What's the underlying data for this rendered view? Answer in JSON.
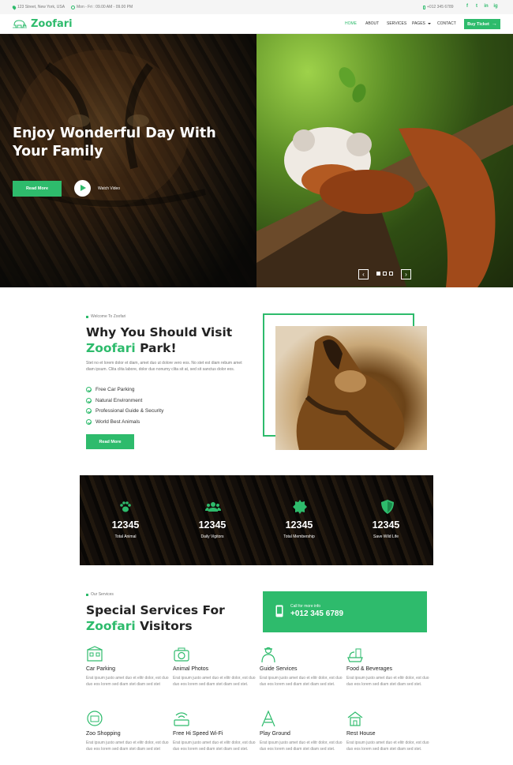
{
  "topbar": {
    "address": "123 Street, New York, USA",
    "hours": "Mon - Fri : 09.00 AM - 09.00 PM",
    "phone": "+012 345 6789",
    "social": [
      "f",
      "t",
      "in",
      "ig"
    ]
  },
  "brand": {
    "name": "Zoofari",
    "color": "#2ebb6c"
  },
  "nav": {
    "items": [
      "HOME",
      "ABOUT",
      "SERVICES",
      "PAGES",
      "CONTACT"
    ],
    "buy_ticket": "Buy Ticket"
  },
  "hero": {
    "title": "Enjoy Wonderful Day With Your Family",
    "read_more": "Read More",
    "watch_video": "Watch Video",
    "prev": "‹",
    "next": "›"
  },
  "about": {
    "tag": "Welcome To Zoofari",
    "heading_line1": "Why You Should Visit",
    "heading_green": "Zoofari",
    "heading_rest": " Park!",
    "paragraph": "Stet no et lorem dolor et diam, amet duo ut dolore vero eos. No stet est diam rebum amet diam ipsum. Clita clita labore, dolor duo nonumy clita sit at, sed sit sanctus dolor eos.",
    "features": [
      "Free Car Parking",
      "Natural Environment",
      "Professional Guide & Security",
      "World Best Animals"
    ],
    "read_more": "Read More"
  },
  "stats": [
    {
      "icon": "paw-icon",
      "value": "12345",
      "label": "Total Animal"
    },
    {
      "icon": "users-icon",
      "value": "12345",
      "label": "Daily Vigitors"
    },
    {
      "icon": "certificate-icon",
      "value": "12345",
      "label": "Total Membership"
    },
    {
      "icon": "shield-icon",
      "value": "12345",
      "label": "Save Wild Life"
    }
  ],
  "services": {
    "tag": "Our Services",
    "heading_line1": "Special Services For",
    "heading_green": "Zoofari",
    "heading_rest": " Visitors",
    "call_label": "Call for more info",
    "call_number": "+012 345 6789",
    "items": [
      {
        "icon": "car-parking-icon",
        "title": "Car Parking",
        "desc": "Erat ipsum justo amet duo et elitr dolor, est duo duo eos lorem sed diam stet diam sed stet"
      },
      {
        "icon": "camera-icon",
        "title": "Animal Photos",
        "desc": "Erat ipsum justo amet duo et elitr dolor, est duo duo eos lorem sed diam stet diam sed stet."
      },
      {
        "icon": "guide-icon",
        "title": "Guide Services",
        "desc": "Erat ipsum justo amet duo et elitr dolor, est duo duo eos lorem sed diam stet diam sed stet."
      },
      {
        "icon": "food-icon",
        "title": "Food & Beverages",
        "desc": "Erat ipsum justo amet duo et elitr dolor, est duo duo eos lorem sed diam stet diam sed stet."
      },
      {
        "icon": "shopping-icon",
        "title": "Zoo Shopping",
        "desc": "Erat ipsum justo amet duo et elitr dolor, est duo duo eos lorem sed diam stet diam sed stet"
      },
      {
        "icon": "wifi-icon",
        "title": "Free Hi Speed Wi-Fi",
        "desc": "Erat ipsum justo amet duo et elitr dolor, est duo duo eos lorem sed diam stet diam sed stet."
      },
      {
        "icon": "playground-icon",
        "title": "Play Ground",
        "desc": "Erat ipsum justo amet duo et elitr dolor, est duo duo eos lorem sed diam stet diam sed stet."
      },
      {
        "icon": "rest-house-icon",
        "title": "Rest House",
        "desc": "Erat ipsum justo amet duo et elitr dolor, est duo duo eos lorem sed diam stet diam sed stet."
      }
    ]
  }
}
